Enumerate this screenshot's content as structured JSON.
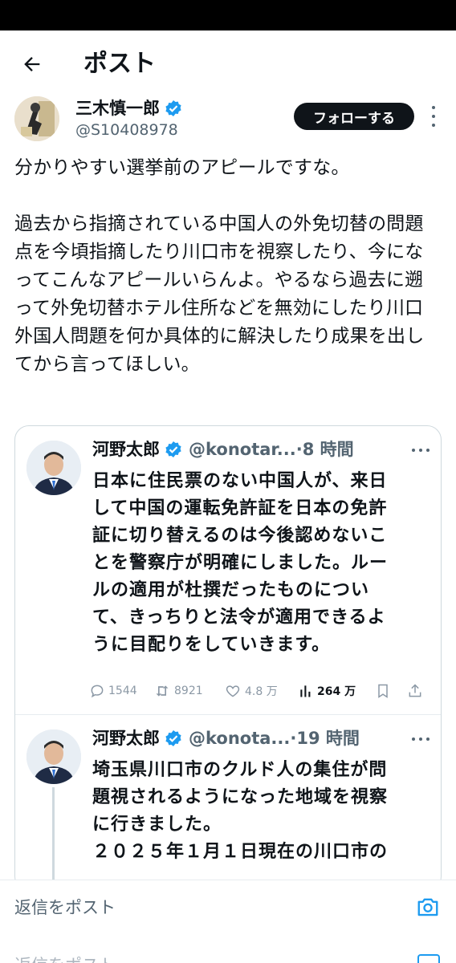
{
  "header": {
    "title": "ポスト",
    "back_icon": "arrow-left-icon"
  },
  "author": {
    "name": "三木慎一郎",
    "handle": "@S10408978",
    "verified": true,
    "follow_label": "フォローする"
  },
  "post": {
    "paragraphs": [
      "分かりやすい選挙前のアピールですな。",
      "過去から指摘されている中国人の外免切替の問題点を今頃指摘したり川口市を視察したり、今になってこんなアピールいらんよ。やるなら過去に遡って外免切替ホテル住所などを無効にしたり川口外国人問題を何か具体的に解決したり成果を出してから言ってほしい。"
    ]
  },
  "quote": {
    "posts": [
      {
        "name": "河野太郎",
        "handle": "@konotar...",
        "time": "·8 時間",
        "lines": [
          "日本に住民票のない中国人が、来日",
          "して中国の運転免許証を日本の免許",
          "証に切り替えるのは今後認めないこ",
          "とを警察庁が明確にしました。ルー",
          "ルの適用が杜撰だったものについ",
          "て、きっちりと法令が適用できるよ",
          "うに目配りをしていきます。"
        ],
        "stats": {
          "replies": "1544",
          "reposts": "8921",
          "likes": "4.8 万",
          "views": "264 万"
        }
      },
      {
        "name": "河野太郎",
        "handle": "@konota...",
        "time": "·19 時間",
        "lines": [
          "埼玉県川口市のクルド人の集住が問",
          "題視されるようになった地域を視察",
          "に行きました。",
          "２０２５年１月１日現在の川口市の"
        ]
      }
    ]
  },
  "reply_bar": {
    "placeholder": "返信をポスト",
    "camera_icon": "camera-icon"
  },
  "colors": {
    "accent": "#1d9bf0",
    "text": "#0f1419",
    "muted": "#536471",
    "border": "#cfd9de"
  }
}
